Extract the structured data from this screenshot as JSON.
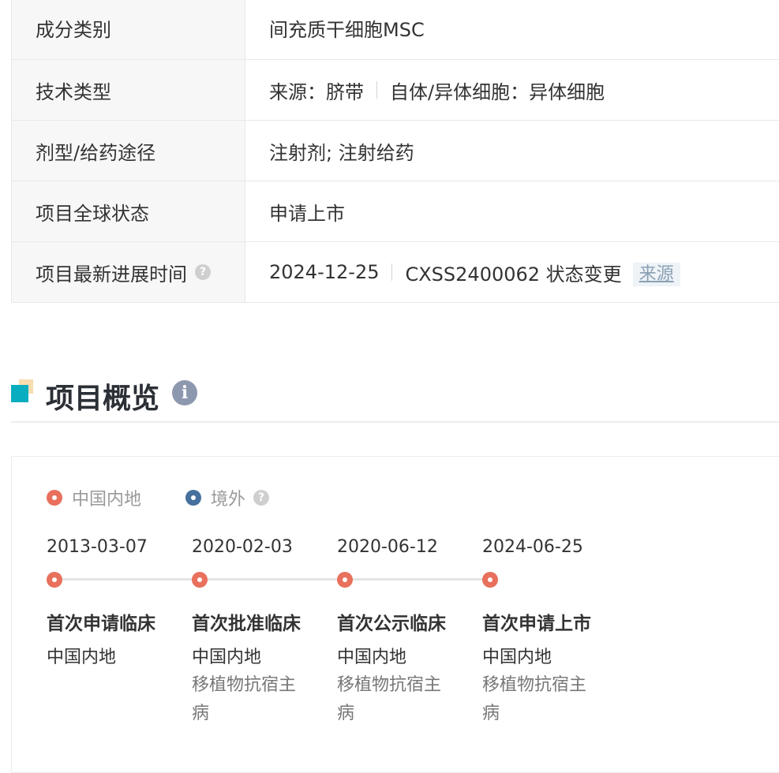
{
  "info_rows": [
    {
      "label": "成分类别",
      "value": "间充质干细胞MSC"
    },
    {
      "label": "技术类型",
      "part1": "来源：脐带",
      "part2": "自体/异体细胞：异体细胞"
    },
    {
      "label": "剂型/给药途径",
      "value": "注射剂; 注射给药"
    },
    {
      "label": "项目全球状态",
      "value": "申请上市"
    },
    {
      "label": "项目最新进展时间",
      "date": "2024-12-25",
      "detail": "CXSS2400062 状态变更",
      "source": "来源",
      "help": "?"
    }
  ],
  "section": {
    "title": "项目概览",
    "info_glyph": "i"
  },
  "legend": {
    "domestic": "中国内地",
    "overseas": "境外",
    "help": "?"
  },
  "colors": {
    "domestic": "#e8705c",
    "overseas": "#46709e",
    "accent": "#08aebf"
  },
  "timeline": [
    {
      "date": "2013-03-07",
      "title": "首次申请临床",
      "region": "中国内地",
      "indication": ""
    },
    {
      "date": "2020-02-03",
      "title": "首次批准临床",
      "region": "中国内地",
      "indication": "移植物抗宿主病"
    },
    {
      "date": "2020-06-12",
      "title": "首次公示临床",
      "region": "中国内地",
      "indication": "移植物抗宿主病"
    },
    {
      "date": "2024-06-25",
      "title": "首次申请上市",
      "region": "中国内地",
      "indication": "移植物抗宿主病"
    }
  ]
}
